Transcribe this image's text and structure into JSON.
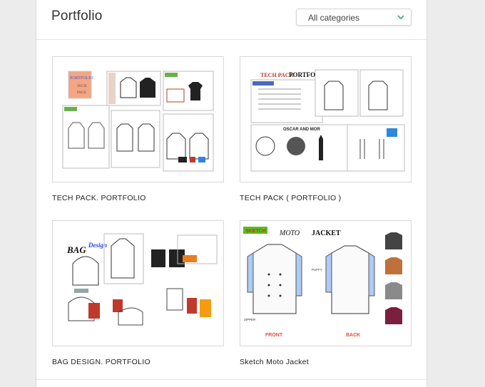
{
  "page": {
    "title": "Portfolio"
  },
  "filter": {
    "selected": "All categories",
    "icon": "chevron-down-icon",
    "accent": "#3cb371"
  },
  "items": [
    {
      "caption": "TECH PACK. PORTFOLIO",
      "art": {
        "cover_lines": [
          "PORTFOLIO",
          "TECH",
          "PACK"
        ]
      }
    },
    {
      "caption": "TECH PACK ( PORTFOLIO )",
      "art": {
        "logo_a": "TECH PACK",
        "logo_b": "PORTFOLIO",
        "label": "OSCAR AND MOR"
      }
    },
    {
      "caption": "BAG DESIGN. PORTFOLIO",
      "art": {
        "logo_a": "BAG",
        "logo_b": "Design"
      }
    },
    {
      "caption": "Sketch Moto Jacket",
      "art": {
        "tag": "SKETCH",
        "title_a": "MOTO",
        "title_b": "JACKET",
        "front": "FRONT",
        "back": "BACK",
        "note_zipper": "ZIPPER",
        "note_puffy": "PUFFY"
      }
    }
  ]
}
